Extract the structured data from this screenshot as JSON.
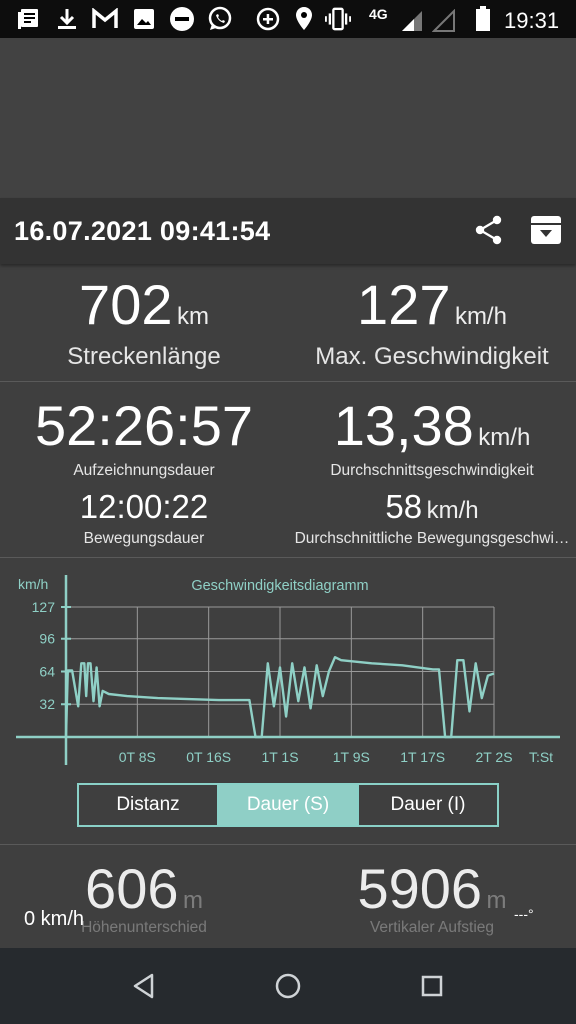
{
  "statusbar": {
    "network": "4G",
    "time": "19:31",
    "icons": [
      "news-icon",
      "download-icon",
      "gmail-icon",
      "image-icon",
      "do-not-disturb-icon",
      "whatsapp-icon",
      "data-saver-icon",
      "location-icon",
      "vibrate-icon",
      "signal-icon",
      "signal-empty-icon",
      "battery-icon"
    ]
  },
  "header": {
    "title": "16.07.2021 09:41:54",
    "share_icon": "share-icon",
    "archive_icon": "archive-download-icon"
  },
  "stats": {
    "distance": {
      "value": "702",
      "unit": "km",
      "label": "Streckenlänge"
    },
    "max_speed": {
      "value": "127",
      "unit": "km/h",
      "label": "Max. Geschwindigkeit"
    },
    "duration": {
      "value": "52:26:57",
      "label": "Aufzeichnungsdauer"
    },
    "avg_speed": {
      "value": "13,38",
      "unit": "km/h",
      "label": "Durchschnittsgeschwindigkeit"
    },
    "moving_time": {
      "value": "12:00:22",
      "label": "Bewegungsdauer"
    },
    "avg_moving_speed": {
      "value": "58",
      "unit": "km/h",
      "label": "Durchschnittliche Bewegungsgeschwi…"
    }
  },
  "chart": {
    "y_unit": "km/h",
    "title": "Geschwindigkeitsdiagramm",
    "y_ticks": [
      "127",
      "96",
      "64",
      "32"
    ],
    "x_ticks": [
      "0T 8S",
      "0T 16S",
      "1T 1S",
      "1T 9S",
      "1T 17S",
      "2T 2S"
    ],
    "x_unit": "T:St",
    "line_color": "#8fd0c6",
    "grid_color": "#9a9a9a"
  },
  "chart_data": {
    "type": "line",
    "title": "Geschwindigkeitsdiagramm",
    "xlabel": "T:St",
    "ylabel": "km/h",
    "ylim": [
      0,
      127
    ],
    "x_tick_labels": [
      "0T 8S",
      "0T 16S",
      "1T 1S",
      "1T 9S",
      "1T 17S",
      "2T 2S"
    ],
    "y_tick_labels": [
      "127",
      "96",
      "64",
      "32"
    ],
    "series": [
      {
        "x": [
          0,
          0.3,
          1,
          2,
          2.5,
          3,
          3.3,
          3.6,
          4,
          4.5,
          5,
          5.5,
          6,
          7,
          10,
          15,
          20,
          25,
          30,
          31,
          32,
          33,
          34,
          35,
          36,
          37,
          38,
          39,
          40,
          41,
          42,
          43,
          44,
          45,
          50,
          55,
          60,
          61,
          62,
          63,
          64,
          65,
          66,
          67,
          68,
          69,
          70
        ],
        "y": [
          0,
          65,
          65,
          30,
          72,
          72,
          40,
          72,
          72,
          35,
          68,
          30,
          45,
          42,
          40,
          38,
          37,
          36,
          36,
          0,
          0,
          72,
          30,
          68,
          20,
          72,
          35,
          68,
          28,
          70,
          40,
          64,
          78,
          75,
          72,
          70,
          66,
          66,
          0,
          0,
          75,
          75,
          25,
          72,
          38,
          60,
          62
        ]
      }
    ]
  },
  "segment": {
    "options": [
      "Distanz",
      "Dauer (S)",
      "Dauer (I)"
    ],
    "selected": "Dauer (S)"
  },
  "bottom": {
    "elevation_diff": {
      "value": "606",
      "unit": "m",
      "label": "Höhenunterschied"
    },
    "vertical_ascent": {
      "value": "5906",
      "unit": "m",
      "label": "Vertikaler Aufstieg"
    },
    "current_speed": "0 km/h",
    "heading": "---°"
  },
  "navbar": {
    "back": "back-icon",
    "home": "home-icon",
    "recents": "recents-icon"
  }
}
